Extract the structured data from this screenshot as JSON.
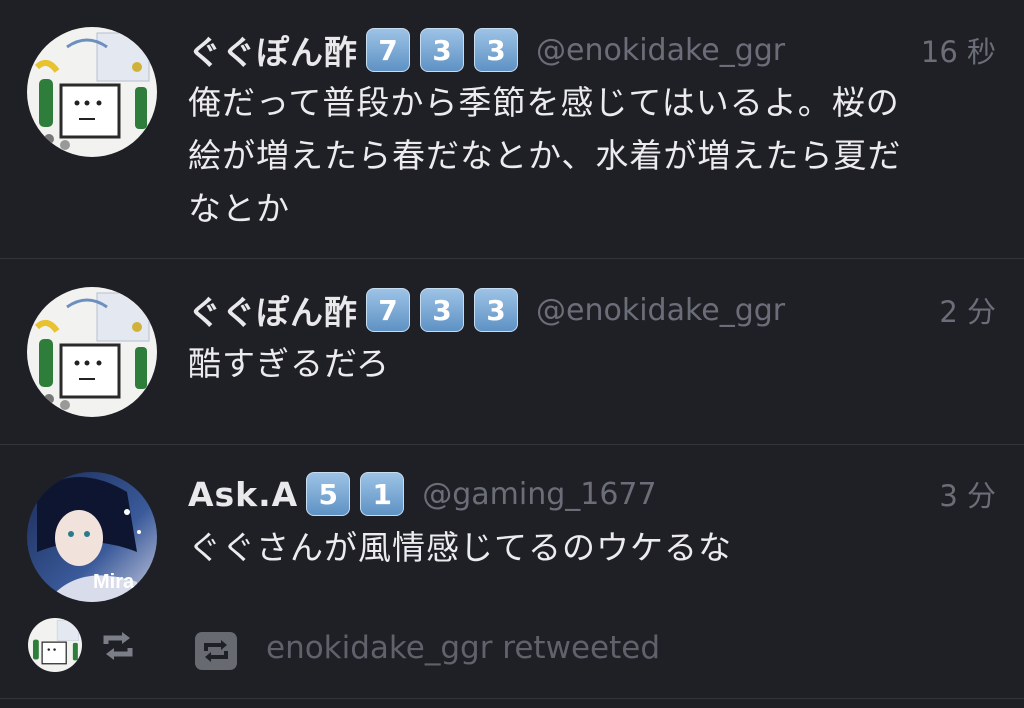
{
  "tweets": [
    {
      "display_name": "ぐぐぽん酢",
      "badges": [
        "7",
        "3",
        "3"
      ],
      "handle": "@enokidake_ggr",
      "time": "16 秒",
      "lines": [
        "俺だって普段から季節を感じてはいるよ。桜の",
        "絵が増えたら春だなとか、水着が増えたら夏だ",
        "なとか"
      ],
      "avatar_icon": "cartoon-face-avatar"
    },
    {
      "display_name": "ぐぐぽん酢",
      "badges": [
        "7",
        "3",
        "3"
      ],
      "handle": "@enokidake_ggr",
      "time": "2 分",
      "lines": [
        "酷すぎるだろ"
      ],
      "avatar_icon": "cartoon-face-avatar"
    },
    {
      "display_name": "Ask.A",
      "badges": [
        "5",
        "1"
      ],
      "handle": "@gaming_1677",
      "time": "3 分",
      "lines": [
        "ぐぐさんが風情感じてるのウケるな"
      ],
      "avatar_icon": "anime-girl-avatar",
      "avatar_text": "Mira",
      "retweet": {
        "text": "enokidake_ggr retweeted",
        "icon": "retweet-icon"
      }
    }
  ],
  "colors": {
    "background": "#1f2025",
    "badge": "#6f9fd0",
    "text": "#ececef",
    "muted": "#6b6e78"
  }
}
